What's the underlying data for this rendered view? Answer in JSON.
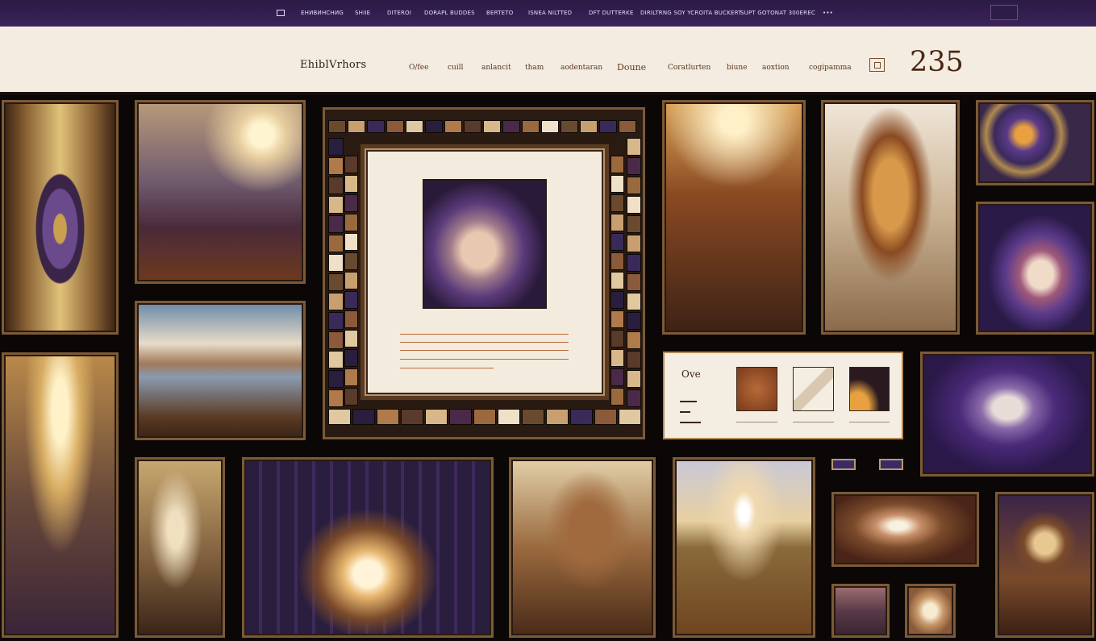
{
  "topbar": {
    "items": [
      "ЕНИВИНСНИG",
      "SHIIE",
      "DITEROI",
      "DORAPL BUDDES",
      "BERTETO",
      "ISNEA NILTTED",
      "DFT DUTTERKE",
      "DIRILTRNG SOY YCROITA BUCKERT",
      "SUPT GOTONAT 300EREC",
      "•••"
    ]
  },
  "header": {
    "logo": "EhiblVrhors",
    "nav": [
      "O/fee",
      "cuill",
      "anlancit",
      "tham",
      "aodentaran",
      "Doune",
      "Coratlurten",
      "biune",
      "aoxtion",
      "cogipamma"
    ],
    "count": "235"
  },
  "info_card": {
    "title": "Ove"
  },
  "colors": {
    "topbar": "#2c1a46",
    "header_bg": "#f4ece0",
    "frame_gold": "#7b5a36",
    "accent_text": "#4a2614"
  }
}
